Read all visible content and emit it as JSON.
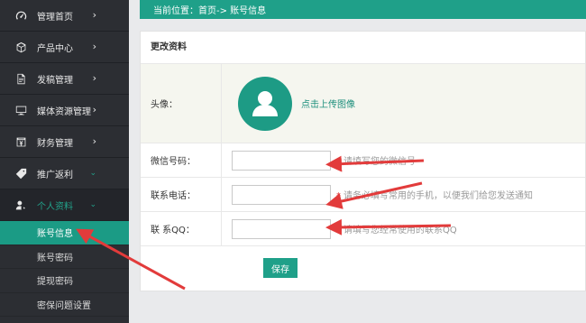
{
  "sidebar": {
    "items": [
      {
        "label": "管理首页",
        "icon": "dashboard-icon"
      },
      {
        "label": "产品中心",
        "icon": "cube-icon"
      },
      {
        "label": "发稿管理",
        "icon": "document-icon"
      },
      {
        "label": "媒体资源管理",
        "icon": "monitor-icon"
      },
      {
        "label": "财务管理",
        "icon": "finance-icon"
      },
      {
        "label": "推广返利",
        "icon": "tag-icon"
      },
      {
        "label": "个人资料",
        "icon": "user-settings-icon"
      }
    ],
    "sub_items": [
      "账号信息",
      "账号密码",
      "提现密码",
      "密保问题设置"
    ]
  },
  "breadcrumb": "当前位置：首页-> 账号信息",
  "panel": {
    "title": "更改资料",
    "avatar_label": "头像：",
    "upload_link": "点击上传图像",
    "fields": [
      {
        "label": "微信号码：",
        "value": "",
        "hint": "请填写您的微信号"
      },
      {
        "label": "联系电话：",
        "value": "",
        "hint": "请务必填写常用的手机，以便我们给您发送通知"
      },
      {
        "label": "联 系QQ：",
        "value": "",
        "hint": "请填写您经常使用的联系QQ"
      }
    ],
    "save_label": "保存"
  },
  "colors": {
    "accent": "#1fa089",
    "sidebar_bg": "#2c2e33",
    "arrow": "#e23b3b"
  }
}
